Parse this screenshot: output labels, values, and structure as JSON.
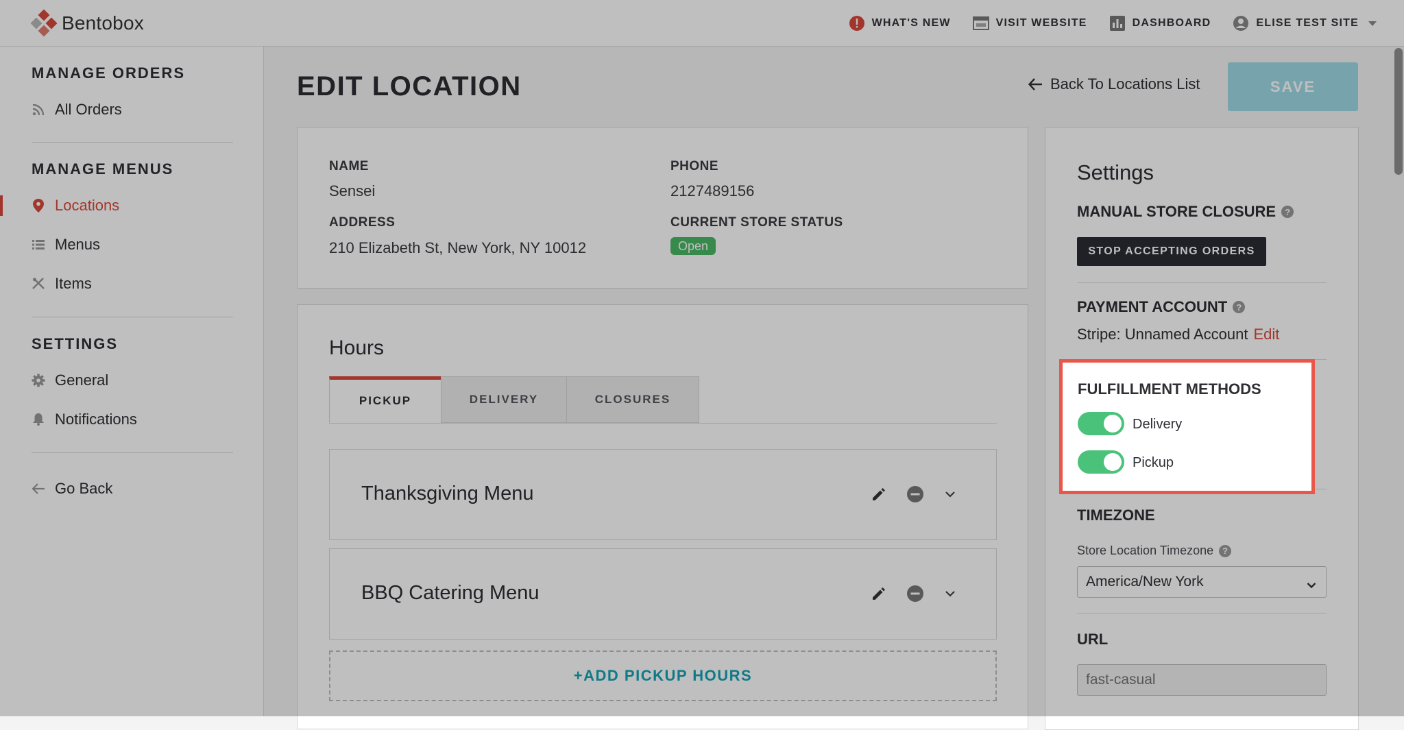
{
  "app": {
    "brand": "Bentobox",
    "nav": {
      "whats_new": "WHAT'S NEW",
      "visit_website": "VISIT WEBSITE",
      "dashboard": "DASHBOARD",
      "account": "ELISE TEST SITE"
    }
  },
  "sidebar": {
    "sections": [
      {
        "heading": "MANAGE ORDERS",
        "items": [
          {
            "label": "All Orders",
            "icon": "rss-icon"
          }
        ]
      },
      {
        "heading": "MANAGE MENUS",
        "items": [
          {
            "label": "Locations",
            "icon": "map-pin-icon",
            "active": true
          },
          {
            "label": "Menus",
            "icon": "list-icon"
          },
          {
            "label": "Items",
            "icon": "utensils-icon"
          }
        ]
      },
      {
        "heading": "SETTINGS",
        "items": [
          {
            "label": "General",
            "icon": "gear-icon"
          },
          {
            "label": "Notifications",
            "icon": "bell-icon"
          }
        ]
      }
    ],
    "go_back": "Go Back"
  },
  "page": {
    "title": "EDIT LOCATION",
    "back_link": "Back To Locations List",
    "save_label": "SAVE"
  },
  "location": {
    "name_label": "NAME",
    "name": "Sensei",
    "phone_label": "PHONE",
    "phone": "2127489156",
    "address_label": "ADDRESS",
    "address": "210 Elizabeth St, New York, NY 10012",
    "status_label": "CURRENT STORE STATUS",
    "status": "Open"
  },
  "hours": {
    "title": "Hours",
    "tabs": [
      "PICKUP",
      "DELIVERY",
      "CLOSURES"
    ],
    "active_tab": "PICKUP",
    "menus": [
      "Thanksgiving Menu",
      "BBQ Catering Menu"
    ],
    "add_label": "+ADD PICKUP HOURS"
  },
  "settings": {
    "title": "Settings",
    "manual_closure": {
      "heading": "MANUAL STORE CLOSURE",
      "button": "STOP ACCEPTING ORDERS"
    },
    "payment": {
      "heading": "PAYMENT ACCOUNT",
      "account": "Stripe: Unnamed Account",
      "edit": "Edit"
    },
    "fulfillment": {
      "heading": "FULFILLMENT METHODS",
      "methods": [
        {
          "label": "Delivery",
          "enabled": true
        },
        {
          "label": "Pickup",
          "enabled": true
        }
      ]
    },
    "timezone": {
      "heading": "TIMEZONE",
      "label": "Store Location Timezone",
      "value": "America/New York"
    },
    "url": {
      "heading": "URL",
      "placeholder": "fast-casual"
    }
  },
  "colors": {
    "accent": "#d9483b",
    "teal": "#14a3b5",
    "toggle_on": "#4bc27a",
    "status_open": "#4bb866",
    "highlight_border": "#e8574a"
  }
}
